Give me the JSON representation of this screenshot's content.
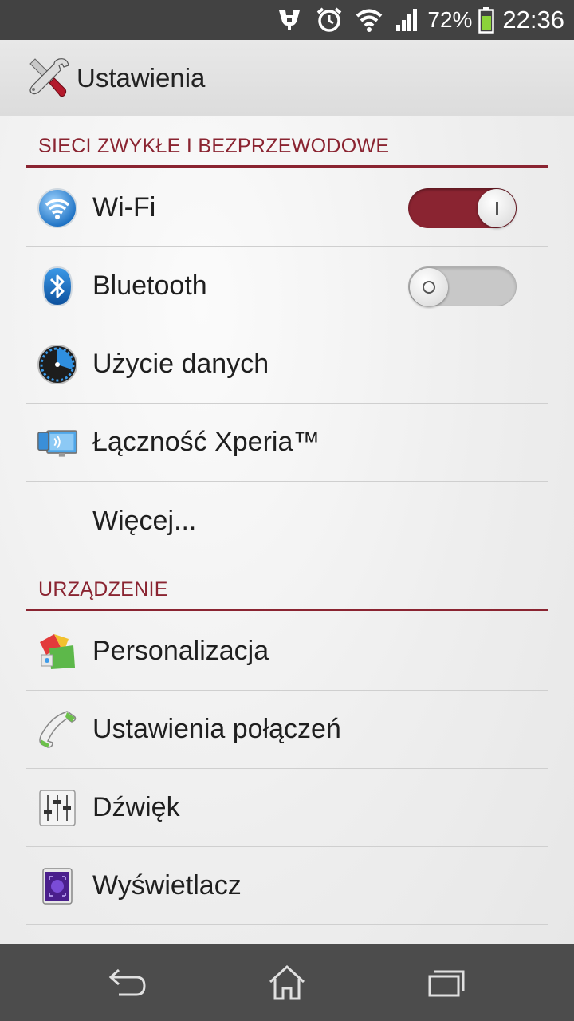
{
  "status_bar": {
    "icons": [
      "usb-debug-icon",
      "alarm-icon",
      "wifi-signal-icon",
      "cell-signal-icon"
    ],
    "battery_percent": "72%",
    "battery_icon": "battery-icon",
    "time": "22:36"
  },
  "action_bar": {
    "icon": "settings-tools-icon",
    "title": "Ustawienia"
  },
  "sections": {
    "wireless": {
      "header": "SIECI ZWYKŁE I BEZPRZEWODOWE",
      "items": {
        "wifi": {
          "label": "Wi-Fi",
          "icon": "wifi-icon",
          "toggle": "on"
        },
        "bluetooth": {
          "label": "Bluetooth",
          "icon": "bluetooth-icon",
          "toggle": "off"
        },
        "data_usage": {
          "label": "Użycie danych",
          "icon": "data-usage-icon"
        },
        "xperia": {
          "label": "Łączność Xperia™",
          "icon": "xperia-connectivity-icon"
        },
        "more": {
          "label": "Więcej..."
        }
      }
    },
    "device": {
      "header": "URZĄDZENIE",
      "items": {
        "personalization": {
          "label": "Personalizacja",
          "icon": "personalization-icon"
        },
        "call_settings": {
          "label": "Ustawienia połączeń",
          "icon": "phone-icon"
        },
        "sound": {
          "label": "Dźwięk",
          "icon": "sound-equalizer-icon"
        },
        "display": {
          "label": "Wyświetlacz",
          "icon": "display-icon"
        }
      }
    }
  },
  "nav_bar": {
    "buttons": [
      "back-icon",
      "home-icon",
      "recent-apps-icon"
    ]
  },
  "colors": {
    "accent": "#8a2431",
    "status_bar": "#424242",
    "nav_bar": "#4c4c4c"
  }
}
